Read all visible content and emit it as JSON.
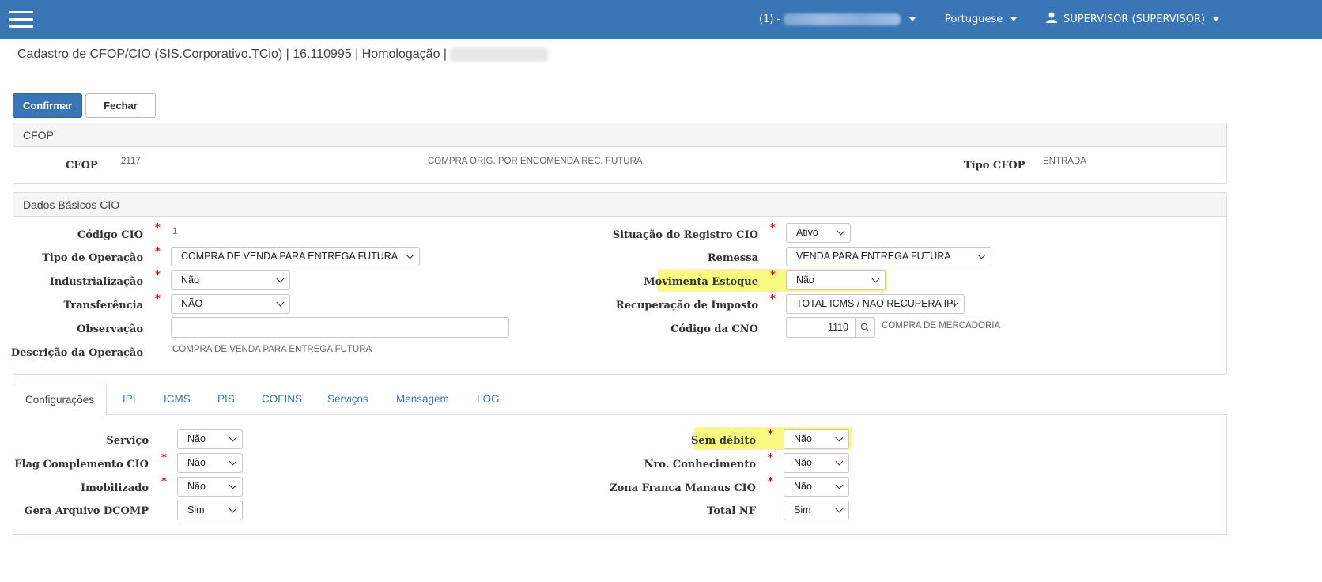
{
  "topbar": {
    "company_prefix": "(1) -",
    "language": "Portuguese",
    "user": "SUPERVISOR (SUPERVISOR)"
  },
  "breadcrumb": "Cadastro de CFOP/CIO (SIS.Corporativo.TCio) | 16.110995 | Homologação |",
  "actions": {
    "confirm": "Confirmar",
    "close": "Fechar"
  },
  "cfop_panel": {
    "title": "CFOP",
    "cfop_label": "CFOP",
    "cfop_value": "2117",
    "cfop_description": "COMPRA ORIG. POR ENCOMENDA REC. FUTURA",
    "tipo_label": "Tipo CFOP",
    "tipo_value": "ENTRADA"
  },
  "cio_panel": {
    "title": "Dados Básicos CIO",
    "codigo_label": "Código CIO",
    "codigo_value": "1",
    "tipo_operacao_label": "Tipo de Operação",
    "tipo_operacao_value": "COMPRA DE VENDA PARA ENTREGA FUTURA",
    "industrializacao_label": "Industrialização",
    "industrializacao_value": "Não",
    "transferencia_label": "Transferência",
    "transferencia_value": "NÃO",
    "observacao_label": "Observação",
    "observacao_value": "",
    "descricao_label": "Descrição da Operação",
    "descricao_value": "COMPRA DE VENDA PARA ENTREGA FUTURA",
    "situacao_label": "Situação do Registro CIO",
    "situacao_value": "Ativo",
    "remessa_label": "Remessa",
    "remessa_value": "VENDA PARA ENTREGA FUTURA",
    "movimenta_label": "Movimenta Estoque",
    "movimenta_value": "Não",
    "recuperacao_label": "Recuperação de Imposto",
    "recuperacao_value": "TOTAL ICMS / NAO RECUPERA IPI",
    "cno_label": "Código da CNO",
    "cno_value": "1110",
    "cno_description": "COMPRA DE MERCADORIA"
  },
  "tabs": [
    "Configurações",
    "IPI",
    "ICMS",
    "PIS",
    "COFINS",
    "Serviços",
    "Mensagem",
    "LOG"
  ],
  "config": {
    "servico_label": "Serviço",
    "servico_value": "Não",
    "flag_label": "Flag Complemento CIO",
    "flag_value": "Não",
    "imobilizado_label": "Imobilizado",
    "imobilizado_value": "Não",
    "dcomp_label": "Gera Arquivo DCOMP",
    "dcomp_value": "Sim",
    "sem_debito_label": "Sem débito",
    "sem_debito_value": "Não",
    "nro_label": "Nro. Conhecimento",
    "nro_value": "Não",
    "zona_label": "Zona Franca Manaus CIO",
    "zona_value": "Não",
    "total_label": "Total NF",
    "total_value": "Sim"
  },
  "required_mark": "*",
  "colors": {
    "topbar": "#3a75b5",
    "highlight": "#fafa82",
    "required": "#e00000"
  }
}
